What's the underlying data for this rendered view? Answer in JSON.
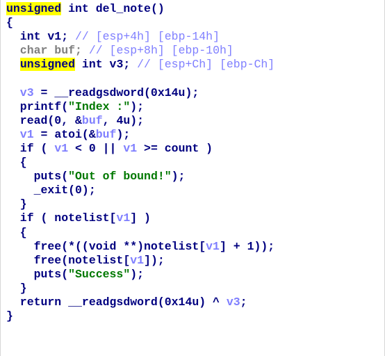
{
  "colors": {
    "background": "#ffffff",
    "keyword": "#000080",
    "highlight": "#ffff00",
    "local_var": "#7f7fff",
    "string": "#007800",
    "comment": "#7f7fff",
    "arg_var": "#7f7f7f"
  },
  "code": {
    "lines": [
      [
        [
          "hl",
          "unsigned"
        ],
        [
          "kw",
          " int del_note()"
        ]
      ],
      [
        [
          "kw",
          "{"
        ]
      ],
      [
        [
          "kw",
          "  int v1; "
        ],
        [
          "cmt",
          "// "
        ],
        [
          "cmt",
          "[esp+4h] [ebp-14h]"
        ]
      ],
      [
        [
          "dvar",
          "  char buf; "
        ],
        [
          "cmt",
          "// "
        ],
        [
          "cmt",
          "[esp+8h] [ebp-10h]"
        ]
      ],
      [
        [
          "kw",
          "  "
        ],
        [
          "hl",
          "unsigned"
        ],
        [
          "kw",
          " int v3; "
        ],
        [
          "cmt",
          "// "
        ],
        [
          "cmt",
          "[esp+Ch] [ebp-Ch]"
        ]
      ],
      [
        [
          "kw",
          ""
        ]
      ],
      [
        [
          "lv",
          "  v3"
        ],
        [
          "kw",
          " = __readgsdword(0x14u);"
        ]
      ],
      [
        [
          "kw",
          "  printf("
        ],
        [
          "str",
          "\"Index :\""
        ],
        [
          "kw",
          ");"
        ]
      ],
      [
        [
          "kw",
          "  read(0, &"
        ],
        [
          "lv",
          "buf"
        ],
        [
          "kw",
          ", 4u);"
        ]
      ],
      [
        [
          "lv",
          "  v1"
        ],
        [
          "kw",
          " = atoi(&"
        ],
        [
          "lv",
          "buf"
        ],
        [
          "kw",
          ");"
        ]
      ],
      [
        [
          "kw",
          "  if ( "
        ],
        [
          "lv",
          "v1"
        ],
        [
          "kw",
          " < 0 || "
        ],
        [
          "lv",
          "v1"
        ],
        [
          "kw",
          " >= count )"
        ]
      ],
      [
        [
          "kw",
          "  {"
        ]
      ],
      [
        [
          "kw",
          "    puts("
        ],
        [
          "str",
          "\"Out of bound!\""
        ],
        [
          "kw",
          ");"
        ]
      ],
      [
        [
          "kw",
          "    _exit(0);"
        ]
      ],
      [
        [
          "kw",
          "  }"
        ]
      ],
      [
        [
          "kw",
          "  if ( notelist["
        ],
        [
          "lv",
          "v1"
        ],
        [
          "kw",
          "] )"
        ]
      ],
      [
        [
          "kw",
          "  {"
        ]
      ],
      [
        [
          "kw",
          "    free(*((void **)notelist["
        ],
        [
          "lv",
          "v1"
        ],
        [
          "kw",
          "] + 1));"
        ]
      ],
      [
        [
          "kw",
          "    free(notelist["
        ],
        [
          "lv",
          "v1"
        ],
        [
          "kw",
          "]);"
        ]
      ],
      [
        [
          "kw",
          "    puts("
        ],
        [
          "str",
          "\"Success\""
        ],
        [
          "kw",
          ");"
        ]
      ],
      [
        [
          "kw",
          "  }"
        ]
      ],
      [
        [
          "kw",
          "  return __readgsdword(0x14u) ^ "
        ],
        [
          "lv",
          "v3"
        ],
        [
          "kw",
          ";"
        ]
      ],
      [
        [
          "kw",
          "}"
        ]
      ]
    ]
  }
}
